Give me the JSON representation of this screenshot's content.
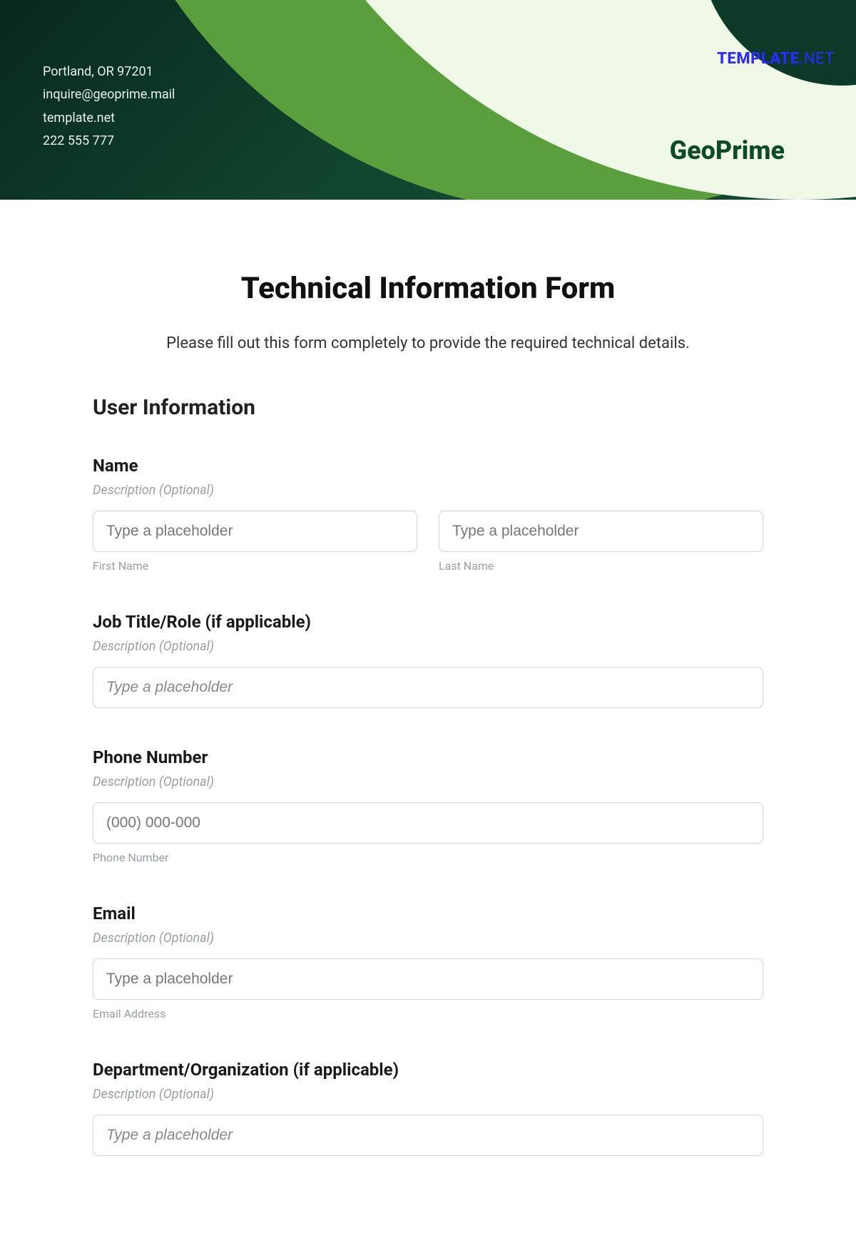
{
  "header": {
    "contact": {
      "line1": "Portland, OR 97201",
      "line2": "inquire@geoprime.mail",
      "line3": "template.net",
      "line4": "222 555 777"
    },
    "brand": "GeoPrime",
    "watermark_bold": "TEMPLATE",
    "watermark_thin": ".NET"
  },
  "form": {
    "title": "Technical Information Form",
    "subtitle": "Please fill out this form completely to provide the required technical details.",
    "section1": "User Information",
    "desc_optional": "Description (Optional)",
    "name": {
      "label": "Name",
      "first_ph": "Type a placeholder",
      "first_sub": "First Name",
      "last_ph": "Type a placeholder",
      "last_sub": "Last Name"
    },
    "job": {
      "label": "Job Title/Role (if applicable)",
      "ph": "Type a placeholder"
    },
    "phone": {
      "label": "Phone Number",
      "ph": "(000) 000-000",
      "sub": "Phone Number"
    },
    "email": {
      "label": "Email",
      "ph": "Type a placeholder",
      "sub": "Email Address"
    },
    "dept": {
      "label": "Department/Organization (if applicable)",
      "ph": "Type a placeholder"
    }
  }
}
